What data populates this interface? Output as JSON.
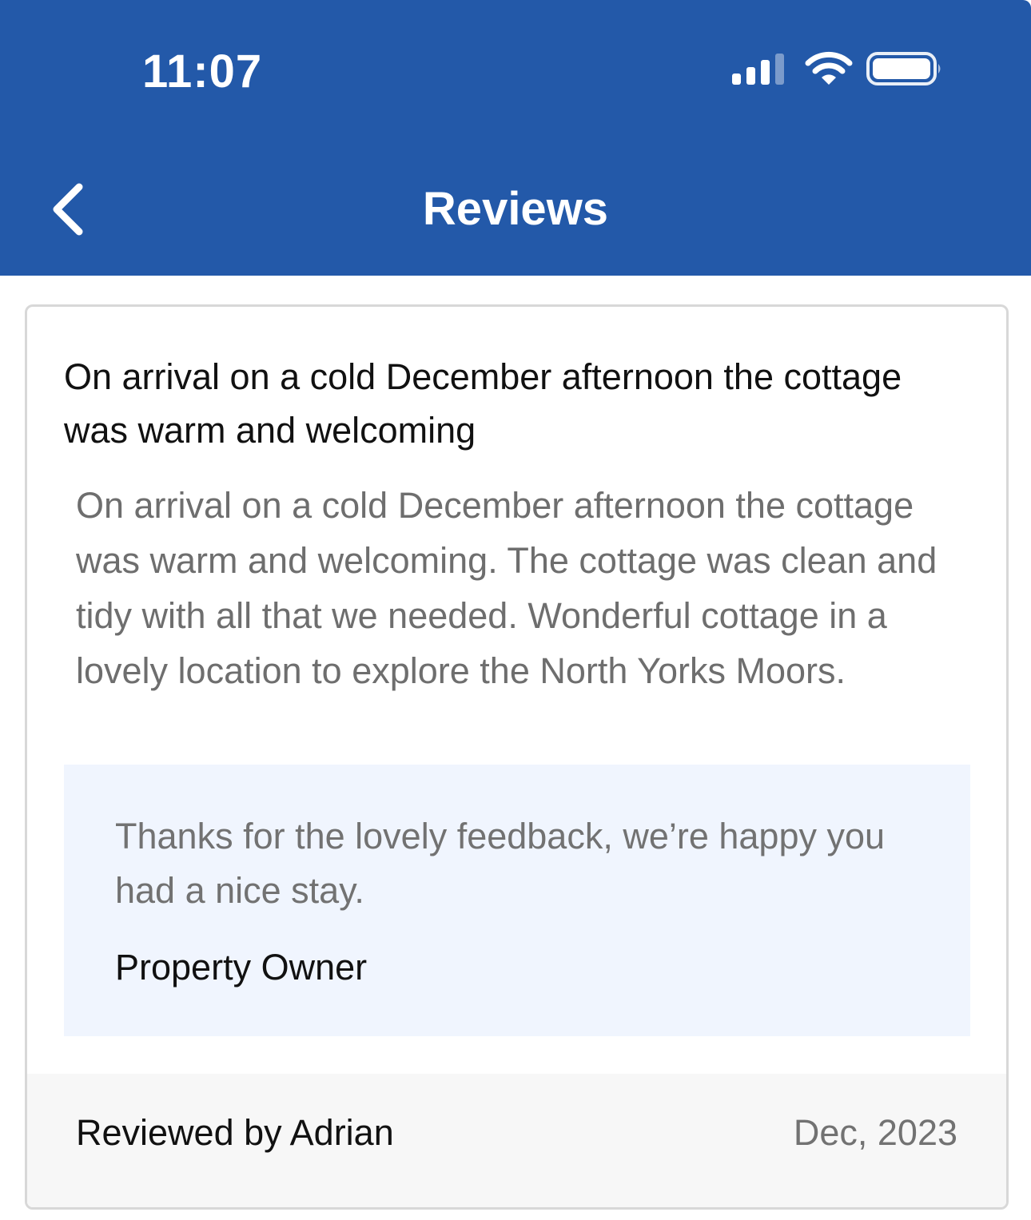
{
  "status_bar": {
    "time": "11:07"
  },
  "header": {
    "title": "Reviews",
    "back_icon": "chevron-left-icon",
    "background_color": "#2359a9"
  },
  "review": {
    "title": "On arrival on a cold December afternoon the cottage was warm and welcoming",
    "body": "On arrival on a cold December afternoon the cottage was warm and welcoming. The cottage was clean and tidy with all that we needed. Wonderful cottage in a lovely location to explore the North Yorks Moors.",
    "owner_reply": {
      "text": "Thanks for the lovely feedback, we’re happy you had a nice stay.",
      "author": "Property Owner"
    },
    "reviewer": "Reviewed by Adrian",
    "date": "Dec, 2023"
  }
}
